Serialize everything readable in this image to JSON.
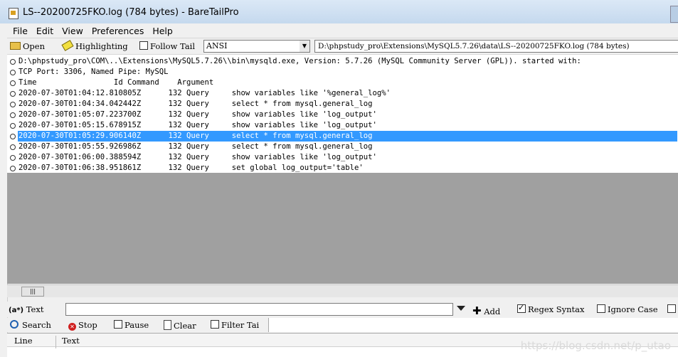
{
  "window": {
    "title": "LS--20200725FKO.log (784 bytes) - BareTailPro"
  },
  "menu": [
    "File",
    "Edit",
    "View",
    "Preferences",
    "Help"
  ],
  "toolbar": {
    "open_label": "Open",
    "highlighting_label": "Highlighting",
    "follow_tail_label": "Follow Tail",
    "follow_tail_checked": false,
    "encoding_value": "ANSI",
    "file_path": "D:\\phpstudy_pro\\Extensions\\MySQL5.7.26\\data\\LS--20200725FKO.log (784 bytes)"
  },
  "log": {
    "selected_index": 7,
    "lines": [
      "D:\\phpstudy_pro\\COM\\..\\Extensions\\MySQL5.7.26\\\\bin\\mysqld.exe, Version: 5.7.26 (MySQL Community Server (GPL)). started with:",
      "TCP Port: 3306, Named Pipe: MySQL",
      "Time                 Id Command    Argument",
      "2020-07-30T01:04:12.810805Z      132 Query     show variables like '%general_log%'",
      "2020-07-30T01:04:34.042442Z      132 Query     select * from mysql.general_log",
      "2020-07-30T01:05:07.223700Z      132 Query     show variables like 'log_output'",
      "2020-07-30T01:05:15.678915Z      132 Query     show variables like 'log_output'",
      "2020-07-30T01:05:29.906140Z      132 Query     select * from mysql.general_log",
      "2020-07-30T01:05:55.926986Z      132 Query     select * from mysql.general_log",
      "2020-07-30T01:06:00.388594Z      132 Query     show variables like 'log_output'",
      "2020-07-30T01:06:38.951861Z      132 Query     set global log_output='table'"
    ]
  },
  "filter": {
    "text_label": "Text",
    "text_prefix": "(a*)",
    "input_value": "",
    "add_label": "Add",
    "regex_label": "Regex Syntax",
    "regex_checked": true,
    "ignore_case_label": "Ignore Case",
    "ignore_case_checked": false
  },
  "search": {
    "search_label": "Search",
    "stop_label": "Stop",
    "pause_label": "Pause",
    "clear_label": "Clear",
    "filter_tail_label": "Filter Tai"
  },
  "results": {
    "col_line": "Line",
    "col_text": "Text"
  },
  "watermark": "https://blog.csdn.net/p_utao"
}
